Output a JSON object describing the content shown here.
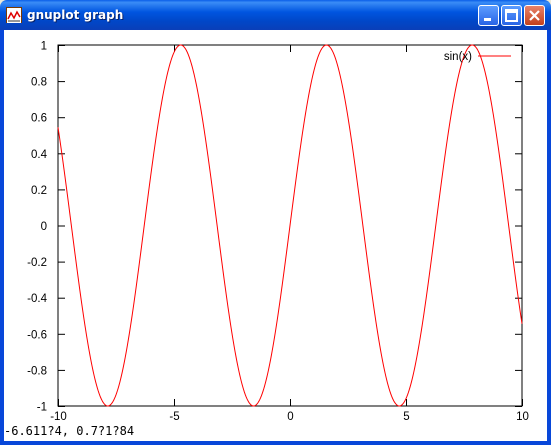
{
  "window": {
    "title": "gnuplot graph",
    "buttons": [
      "minimize",
      "maximize",
      "close"
    ]
  },
  "status": {
    "coords": "-6.611?4, 0.7?1?84"
  },
  "chart_data": {
    "type": "line",
    "function": "sin(x)",
    "series": [
      {
        "name": "sin(x)",
        "color": "#ff0000"
      }
    ],
    "xlim": [
      -10,
      10
    ],
    "ylim": [
      -1,
      1
    ],
    "xticks": [
      "-10",
      "-5",
      "0",
      "5",
      "10"
    ],
    "yticks": [
      "-1",
      "-0.8",
      "-0.6",
      "-0.4",
      "-0.2",
      "0",
      "0.2",
      "0.4",
      "0.6",
      "0.8",
      "1"
    ],
    "legend": "top-right",
    "grid": false
  }
}
